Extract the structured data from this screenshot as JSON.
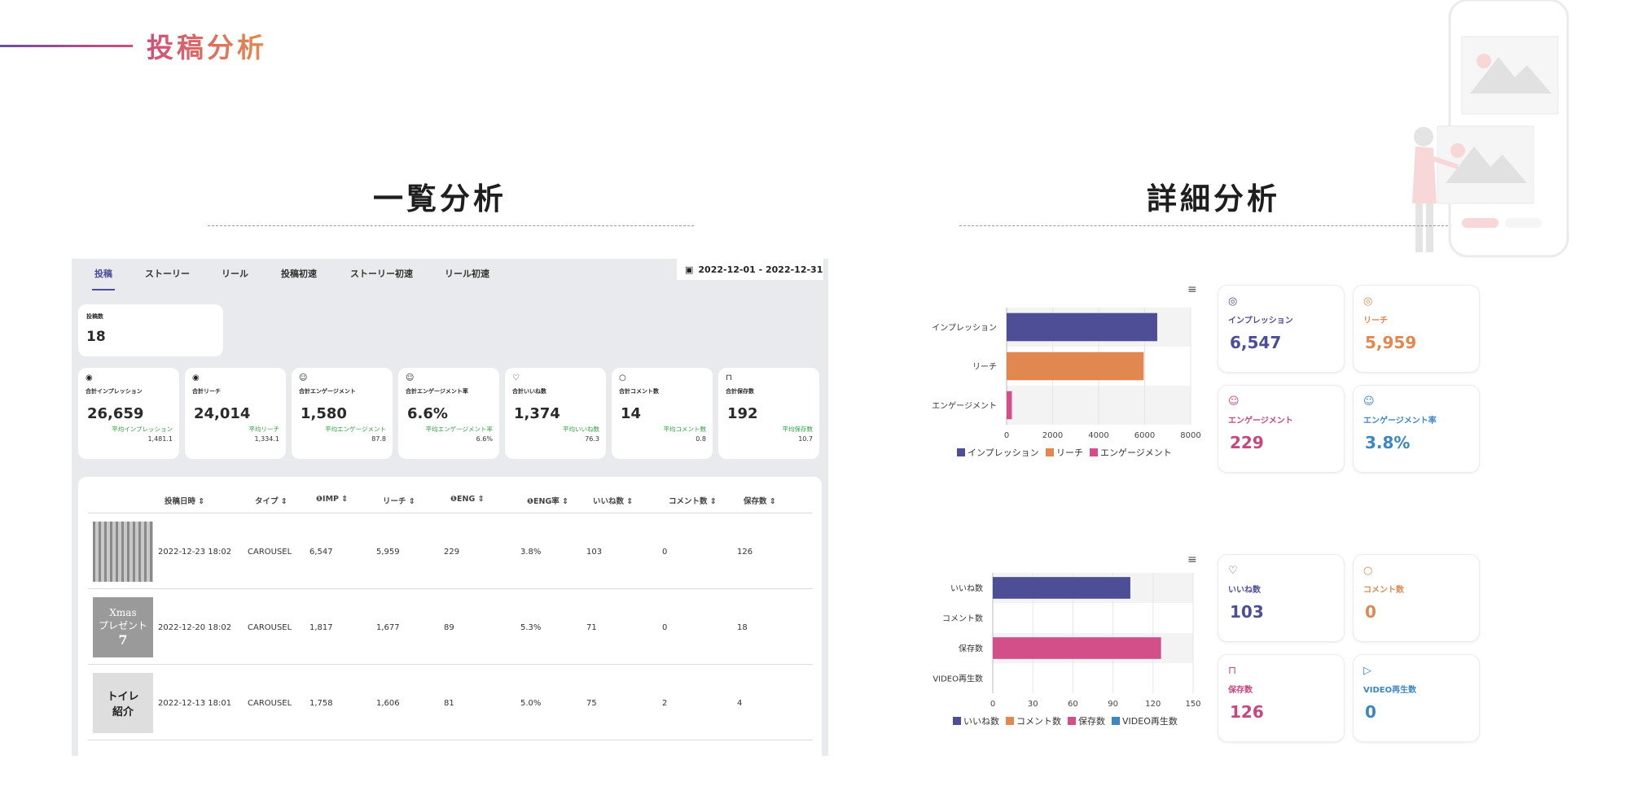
{
  "header": {
    "title": "投稿分析"
  },
  "sections": {
    "list_title": "一覧分析",
    "detail_title": "詳細分析"
  },
  "app": {
    "tabs": [
      "投稿",
      "ストーリー",
      "リール",
      "投稿初速",
      "ストーリー初速",
      "リール初速"
    ],
    "active_tab": "投稿",
    "date_range": "2022-12-01 - 2022-12-31",
    "post_count": {
      "label": "投稿数",
      "value": "18"
    },
    "stats": [
      {
        "icon": "eye-icon",
        "glyph": "◉",
        "label": "合計インプレッション",
        "value": "26,659",
        "sub_label": "平均インプレッション",
        "sub_value": "1,481.1"
      },
      {
        "icon": "eye-icon",
        "glyph": "◉",
        "label": "合計リーチ",
        "value": "24,014",
        "sub_label": "平均リーチ",
        "sub_value": "1,334.1"
      },
      {
        "icon": "smile-icon",
        "glyph": "☺",
        "label": "合計エンゲージメント",
        "value": "1,580",
        "sub_label": "平均エンゲージメント",
        "sub_value": "87.8"
      },
      {
        "icon": "smile-icon",
        "glyph": "☺",
        "label": "合計エンゲージメント率",
        "value": "6.6%",
        "sub_label": "平均エンゲージメント率",
        "sub_value": "6.6%"
      },
      {
        "icon": "heart-icon",
        "glyph": "♡",
        "label": "合計いいね数",
        "value": "1,374",
        "sub_label": "平均いいね数",
        "sub_value": "76.3"
      },
      {
        "icon": "comment-icon",
        "glyph": "○",
        "label": "合計コメント数",
        "value": "14",
        "sub_label": "平均コメント数",
        "sub_value": "0.8"
      },
      {
        "icon": "bookmark-icon",
        "glyph": "⊓",
        "label": "合計保存数",
        "value": "192",
        "sub_label": "平均保存数",
        "sub_value": "10.7"
      }
    ],
    "table": {
      "headers": [
        "投稿日時 ⇕",
        "タイプ ⇕",
        "❶IMP ⇕",
        "リーチ ⇕",
        "❶ENG ⇕",
        "❶ENG率 ⇕",
        "いいね数 ⇕",
        "コメント数 ⇕",
        "保存数 ⇕"
      ],
      "rows": [
        {
          "date": "2022-12-23 18:02",
          "type": "CAROUSEL",
          "imp": "6,547",
          "reach": "5,959",
          "eng": "229",
          "eng_rate": "3.8%",
          "likes": "103",
          "comments": "0",
          "saves": "126"
        },
        {
          "date": "2022-12-20 18:02",
          "type": "CAROUSEL",
          "imp": "1,817",
          "reach": "1,677",
          "eng": "89",
          "eng_rate": "5.3%",
          "likes": "71",
          "comments": "0",
          "saves": "18"
        },
        {
          "date": "2022-12-13 18:01",
          "type": "CAROUSEL",
          "imp": "1,758",
          "reach": "1,606",
          "eng": "81",
          "eng_rate": "5.0%",
          "likes": "75",
          "comments": "2",
          "saves": "4"
        }
      ],
      "thumb_text": {
        "xmas_1": "Xmas",
        "xmas_2": "プレゼント",
        "xmas_3": "7",
        "toilet_1": "トイレ",
        "toilet_2": "紹介"
      }
    }
  },
  "detail": {
    "cards_top": [
      {
        "icon": "eye-icon",
        "glyph": "◎",
        "label": "インプレッション",
        "value": "6,547",
        "color": "#4a4f98"
      },
      {
        "icon": "eye-icon",
        "glyph": "◎",
        "label": "リーチ",
        "value": "5,959",
        "color": "#e0884f"
      },
      {
        "icon": "smile-icon",
        "glyph": "☺",
        "label": "エンゲージメント",
        "value": "229",
        "color": "#c8467f"
      },
      {
        "icon": "smile-icon",
        "glyph": "☺",
        "label": "エンゲージメント率",
        "value": "3.8%",
        "color": "#3d86c4"
      }
    ],
    "cards_bottom": [
      {
        "icon": "heart-icon",
        "glyph": "♡",
        "label": "いいね数",
        "value": "103",
        "color": "#4a4f98"
      },
      {
        "icon": "comment-icon",
        "glyph": "○",
        "label": "コメント数",
        "value": "0",
        "color": "#e0884f"
      },
      {
        "icon": "bookmark-icon",
        "glyph": "⊓",
        "label": "保存数",
        "value": "126",
        "color": "#c8467f"
      },
      {
        "icon": "play-icon",
        "glyph": "▷",
        "label": "VIDEO再生数",
        "value": "0",
        "color": "#3d86c4"
      }
    ]
  },
  "chart_data": [
    {
      "type": "bar",
      "orientation": "horizontal",
      "categories": [
        "インプレッション",
        "リーチ",
        "エンゲージメント"
      ],
      "values": [
        6547,
        5959,
        229
      ],
      "colors": [
        "#4d4e96",
        "#e0884f",
        "#d24f8a"
      ],
      "xlim": [
        0,
        8000
      ],
      "xticks": [
        0,
        2000,
        4000,
        6000,
        8000
      ],
      "legend": [
        "インプレッション",
        "リーチ",
        "エンゲージメント"
      ],
      "legend_position": "bottom"
    },
    {
      "type": "bar",
      "orientation": "horizontal",
      "categories": [
        "いいね数",
        "コメント数",
        "保存数",
        "VIDEO再生数"
      ],
      "values": [
        103,
        0,
        126,
        0
      ],
      "colors": [
        "#4d4e96",
        "#e0884f",
        "#d24f8a",
        "#3d86c4"
      ],
      "xlim": [
        0,
        150
      ],
      "xticks": [
        0,
        30,
        60,
        90,
        120,
        150
      ],
      "legend": [
        "いいね数",
        "コメント数",
        "保存数",
        "VIDEO再生数"
      ],
      "legend_position": "bottom"
    }
  ]
}
